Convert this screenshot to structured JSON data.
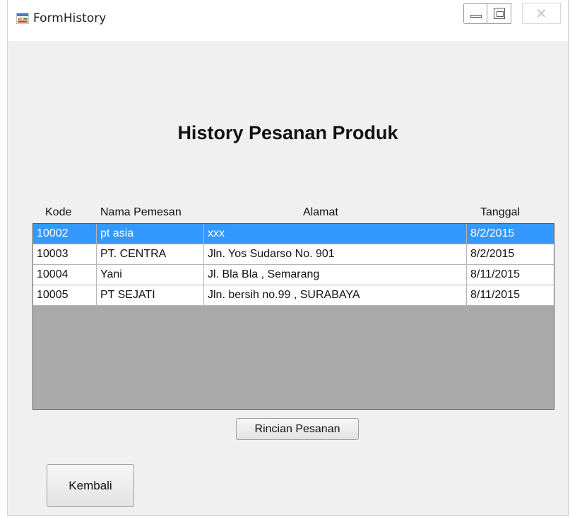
{
  "window": {
    "title": "FormHistory",
    "icon": "form-app-icon",
    "controls": {
      "minimize": "minimize-icon",
      "maximize": "maximize-icon",
      "close": "close-icon"
    }
  },
  "heading": "History Pesanan Produk",
  "grid": {
    "columns": [
      "Kode",
      "Nama Pemesan",
      "Alamat",
      "Tanggal"
    ],
    "rows": [
      {
        "kode": "10002",
        "nama": "pt asia",
        "alamat": "xxx",
        "tanggal": "8/2/2015",
        "selected": true
      },
      {
        "kode": "10003",
        "nama": "PT. CENTRA",
        "alamat": "Jln. Yos Sudarso No. 901",
        "tanggal": "8/2/2015"
      },
      {
        "kode": "10004",
        "nama": "Yani",
        "alamat": "Jl. Bla Bla , Semarang",
        "tanggal": "8/11/2015"
      },
      {
        "kode": "10005",
        "nama": "PT SEJATI",
        "alamat": "Jln. bersih  no.99 , SURABAYA",
        "tanggal": "8/11/2015"
      }
    ]
  },
  "buttons": {
    "rincian": "Rincian Pesanan",
    "kembali": "Kembali"
  },
  "colors": {
    "selection": "#3399ff",
    "grid_background": "#aaaaaa",
    "form_background": "#f0f0f0"
  }
}
